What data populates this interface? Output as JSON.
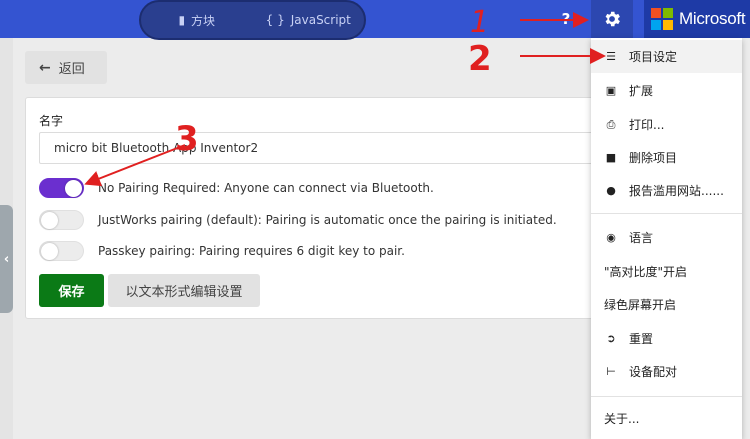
{
  "topbar": {
    "blocks_label": "方块",
    "js_label": "JavaScript",
    "help": "?",
    "brand": "Microsoft"
  },
  "back": {
    "label": "返回"
  },
  "form": {
    "name_label": "名字",
    "name_value": "micro bit Bluetooth App Inventor2",
    "options": [
      {
        "label": "No Pairing Required: Anyone can connect via Bluetooth.",
        "on": true
      },
      {
        "label": "JustWorks pairing (default): Pairing is automatic once the pairing is initiated.",
        "on": false
      },
      {
        "label": "Passkey pairing: Pairing requires 6 digit key to pair.",
        "on": false
      }
    ],
    "save_label": "保存",
    "textedit_label": "以文本形式编辑设置"
  },
  "menu": {
    "items": [
      {
        "label": "项目设定",
        "icon": "sliders-icon"
      },
      {
        "label": "扩展",
        "icon": "drive-icon"
      },
      {
        "label": "打印...",
        "icon": "print-icon"
      },
      {
        "label": "删除项目",
        "icon": "trash-icon"
      },
      {
        "label": "报告滥用网站......",
        "icon": "exclamation-icon"
      },
      {
        "label": "语言",
        "icon": "globe-icon"
      },
      {
        "label": "\"高对比度\"开启",
        "icon": ""
      },
      {
        "label": "绿色屏幕开启",
        "icon": ""
      },
      {
        "label": "重置",
        "icon": "sign-out-icon"
      },
      {
        "label": "设备配对",
        "icon": "usb-icon"
      },
      {
        "label": "关于...",
        "icon": ""
      }
    ]
  },
  "annotations": {
    "n1": "1",
    "n2": "2",
    "n3": "3",
    "color": "#e02020"
  },
  "colors": {
    "topbar": "#3454d1",
    "toggle_on": "#6b2fcf",
    "save": "#0b7a16"
  }
}
